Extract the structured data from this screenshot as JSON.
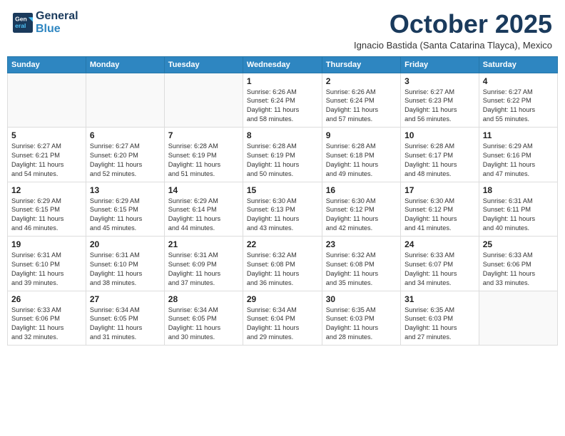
{
  "header": {
    "logo_line1": "General",
    "logo_line2": "Blue",
    "month": "October 2025",
    "location": "Ignacio Bastida (Santa Catarina Tlayca), Mexico"
  },
  "weekdays": [
    "Sunday",
    "Monday",
    "Tuesday",
    "Wednesday",
    "Thursday",
    "Friday",
    "Saturday"
  ],
  "weeks": [
    [
      {
        "day": "",
        "info": ""
      },
      {
        "day": "",
        "info": ""
      },
      {
        "day": "",
        "info": ""
      },
      {
        "day": "1",
        "info": "Sunrise: 6:26 AM\nSunset: 6:24 PM\nDaylight: 11 hours\nand 58 minutes."
      },
      {
        "day": "2",
        "info": "Sunrise: 6:26 AM\nSunset: 6:24 PM\nDaylight: 11 hours\nand 57 minutes."
      },
      {
        "day": "3",
        "info": "Sunrise: 6:27 AM\nSunset: 6:23 PM\nDaylight: 11 hours\nand 56 minutes."
      },
      {
        "day": "4",
        "info": "Sunrise: 6:27 AM\nSunset: 6:22 PM\nDaylight: 11 hours\nand 55 minutes."
      }
    ],
    [
      {
        "day": "5",
        "info": "Sunrise: 6:27 AM\nSunset: 6:21 PM\nDaylight: 11 hours\nand 54 minutes."
      },
      {
        "day": "6",
        "info": "Sunrise: 6:27 AM\nSunset: 6:20 PM\nDaylight: 11 hours\nand 52 minutes."
      },
      {
        "day": "7",
        "info": "Sunrise: 6:28 AM\nSunset: 6:19 PM\nDaylight: 11 hours\nand 51 minutes."
      },
      {
        "day": "8",
        "info": "Sunrise: 6:28 AM\nSunset: 6:19 PM\nDaylight: 11 hours\nand 50 minutes."
      },
      {
        "day": "9",
        "info": "Sunrise: 6:28 AM\nSunset: 6:18 PM\nDaylight: 11 hours\nand 49 minutes."
      },
      {
        "day": "10",
        "info": "Sunrise: 6:28 AM\nSunset: 6:17 PM\nDaylight: 11 hours\nand 48 minutes."
      },
      {
        "day": "11",
        "info": "Sunrise: 6:29 AM\nSunset: 6:16 PM\nDaylight: 11 hours\nand 47 minutes."
      }
    ],
    [
      {
        "day": "12",
        "info": "Sunrise: 6:29 AM\nSunset: 6:15 PM\nDaylight: 11 hours\nand 46 minutes."
      },
      {
        "day": "13",
        "info": "Sunrise: 6:29 AM\nSunset: 6:15 PM\nDaylight: 11 hours\nand 45 minutes."
      },
      {
        "day": "14",
        "info": "Sunrise: 6:29 AM\nSunset: 6:14 PM\nDaylight: 11 hours\nand 44 minutes."
      },
      {
        "day": "15",
        "info": "Sunrise: 6:30 AM\nSunset: 6:13 PM\nDaylight: 11 hours\nand 43 minutes."
      },
      {
        "day": "16",
        "info": "Sunrise: 6:30 AM\nSunset: 6:12 PM\nDaylight: 11 hours\nand 42 minutes."
      },
      {
        "day": "17",
        "info": "Sunrise: 6:30 AM\nSunset: 6:12 PM\nDaylight: 11 hours\nand 41 minutes."
      },
      {
        "day": "18",
        "info": "Sunrise: 6:31 AM\nSunset: 6:11 PM\nDaylight: 11 hours\nand 40 minutes."
      }
    ],
    [
      {
        "day": "19",
        "info": "Sunrise: 6:31 AM\nSunset: 6:10 PM\nDaylight: 11 hours\nand 39 minutes."
      },
      {
        "day": "20",
        "info": "Sunrise: 6:31 AM\nSunset: 6:10 PM\nDaylight: 11 hours\nand 38 minutes."
      },
      {
        "day": "21",
        "info": "Sunrise: 6:31 AM\nSunset: 6:09 PM\nDaylight: 11 hours\nand 37 minutes."
      },
      {
        "day": "22",
        "info": "Sunrise: 6:32 AM\nSunset: 6:08 PM\nDaylight: 11 hours\nand 36 minutes."
      },
      {
        "day": "23",
        "info": "Sunrise: 6:32 AM\nSunset: 6:08 PM\nDaylight: 11 hours\nand 35 minutes."
      },
      {
        "day": "24",
        "info": "Sunrise: 6:33 AM\nSunset: 6:07 PM\nDaylight: 11 hours\nand 34 minutes."
      },
      {
        "day": "25",
        "info": "Sunrise: 6:33 AM\nSunset: 6:06 PM\nDaylight: 11 hours\nand 33 minutes."
      }
    ],
    [
      {
        "day": "26",
        "info": "Sunrise: 6:33 AM\nSunset: 6:06 PM\nDaylight: 11 hours\nand 32 minutes."
      },
      {
        "day": "27",
        "info": "Sunrise: 6:34 AM\nSunset: 6:05 PM\nDaylight: 11 hours\nand 31 minutes."
      },
      {
        "day": "28",
        "info": "Sunrise: 6:34 AM\nSunset: 6:05 PM\nDaylight: 11 hours\nand 30 minutes."
      },
      {
        "day": "29",
        "info": "Sunrise: 6:34 AM\nSunset: 6:04 PM\nDaylight: 11 hours\nand 29 minutes."
      },
      {
        "day": "30",
        "info": "Sunrise: 6:35 AM\nSunset: 6:03 PM\nDaylight: 11 hours\nand 28 minutes."
      },
      {
        "day": "31",
        "info": "Sunrise: 6:35 AM\nSunset: 6:03 PM\nDaylight: 11 hours\nand 27 minutes."
      },
      {
        "day": "",
        "info": ""
      }
    ]
  ]
}
